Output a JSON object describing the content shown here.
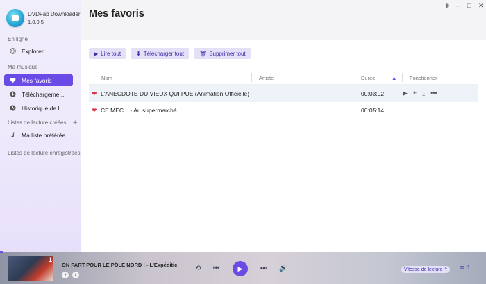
{
  "app": {
    "name": "DVDFab Downloader",
    "version": "1.0.0.5"
  },
  "sidebar": {
    "online_title": "En ligne",
    "explore": "Explorer",
    "music_title": "Ma musique",
    "favorites": "Mes favoris",
    "downloads": "Téléchargeme...",
    "history": "Historique de l...",
    "created_title": "Listes de lecture créées",
    "preferred": "Ma liste préférée",
    "saved_title": "Listes de lecture enregistrées"
  },
  "main": {
    "title": "Mes favoris"
  },
  "toolbar": {
    "play_all": "Lire tout",
    "download_all": "Télécharger tout",
    "delete_all": "Supprimer tout"
  },
  "table": {
    "headers": {
      "name": "Nom",
      "artist": "Artiste",
      "duration": "Durée",
      "actions": "Fonctionner"
    },
    "rows": [
      {
        "title": "L'ANECDOTE DU VIEUX QUI PUE (Animation Officielle)",
        "artist": "",
        "duration": "00:03:02"
      },
      {
        "title": "CE MEC... - Au supermarché",
        "artist": "",
        "duration": "00:05:14"
      }
    ]
  },
  "player": {
    "now_playing": "ON PART POUR LE PÔLE NORD ! - L'Expéditic",
    "thumb_number": "1",
    "speed_label": "Vitesse de lecture",
    "queue_count": "1"
  },
  "colors": {
    "accent": "#6a4be6",
    "heart": "#d63a48"
  }
}
